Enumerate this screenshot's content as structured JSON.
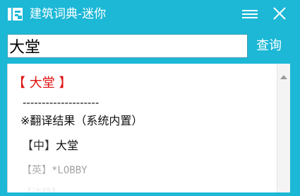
{
  "window": {
    "title": "建筑词典-迷你",
    "accent": "#1cb8d6",
    "icons": {
      "app": "app-logo-icon",
      "menu": "menu-icon",
      "close": "close-icon"
    }
  },
  "search": {
    "value": "大堂",
    "button_label": "查询"
  },
  "result": {
    "entry_title": "【 大堂 】",
    "separator": "--------------------",
    "header": "※翻译结果（系统内置）",
    "rows": [
      {
        "label": "【中】",
        "text": "大堂"
      },
      {
        "label": "【英】",
        "text": "*LOBBY"
      },
      {
        "label": "【注释】",
        "text": ""
      }
    ],
    "title_color": "#e01010"
  },
  "scrollbar": {
    "up_icon": "scroll-up-arrow-icon"
  }
}
